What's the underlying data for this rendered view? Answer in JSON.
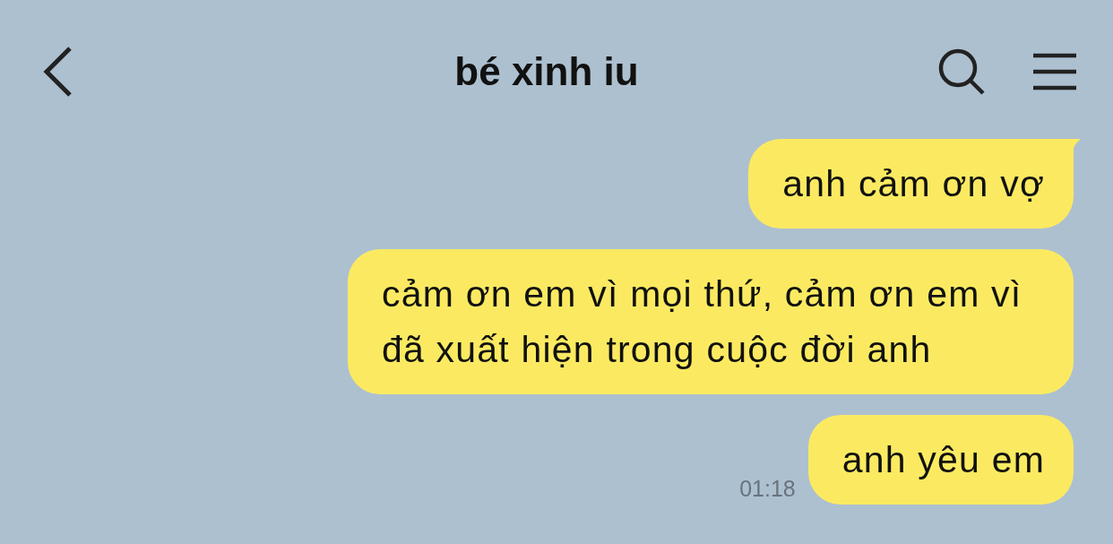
{
  "header": {
    "title": "bé xinh iu"
  },
  "messages": [
    {
      "text": "anh cảm ơn vợ",
      "tail": true
    },
    {
      "text": "cảm ơn em vì mọi thứ, cảm ơn em vì đã xuất hiện trong cuộc đời anh",
      "tail": false
    },
    {
      "text": "anh yêu em",
      "tail": false,
      "time": "01:18"
    }
  ]
}
